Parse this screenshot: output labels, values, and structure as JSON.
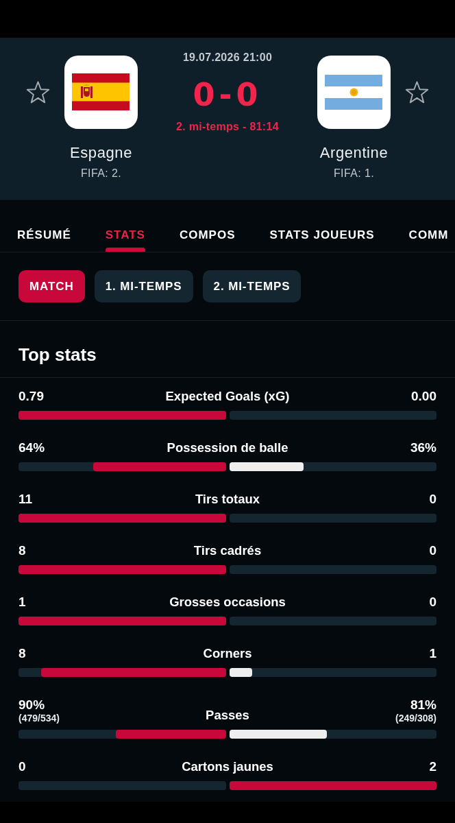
{
  "match": {
    "datetime": "19.07.2026 21:00",
    "score": "0-0",
    "status": "2. mi-temps - 81:14",
    "home": {
      "name": "Espagne",
      "ranking": "FIFA: 2.",
      "favorite": false
    },
    "away": {
      "name": "Argentine",
      "ranking": "FIFA: 1.",
      "favorite": false
    }
  },
  "tabs": [
    {
      "label": "RÉSUMÉ",
      "selected": false
    },
    {
      "label": "STATS",
      "selected": true
    },
    {
      "label": "COMPOS",
      "selected": false
    },
    {
      "label": "STATS JOUEURS",
      "selected": false
    },
    {
      "label": "COMM",
      "selected": false
    }
  ],
  "periods": [
    {
      "label": "MATCH",
      "selected": true
    },
    {
      "label": "1. MI-TEMPS",
      "selected": false
    },
    {
      "label": "2. MI-TEMPS",
      "selected": false
    }
  ],
  "section_title": "Top stats",
  "stats": [
    {
      "label": "Expected Goals (xG)",
      "home": {
        "value": "0.79",
        "level": 1
      },
      "away": {
        "value": "0.00",
        "level": 0
      }
    },
    {
      "label": "Possession de balle",
      "home": {
        "value": "64%",
        "level": 0.64
      },
      "away": {
        "value": "36%",
        "level": 0.36
      }
    },
    {
      "label": "Tirs totaux",
      "home": {
        "value": "11",
        "level": 1
      },
      "away": {
        "value": "0",
        "level": 0
      }
    },
    {
      "label": "Tirs cadrés",
      "home": {
        "value": "8",
        "level": 1
      },
      "away": {
        "value": "0",
        "level": 0
      }
    },
    {
      "label": "Grosses occasions",
      "home": {
        "value": "1",
        "level": 1
      },
      "away": {
        "value": "0",
        "level": 0
      }
    },
    {
      "label": "Corners",
      "home": {
        "value": "8",
        "level": 0.89
      },
      "away": {
        "value": "1",
        "level": 0.11
      }
    },
    {
      "label": "Passes",
      "home": {
        "value": "90%",
        "detail": "(479/534)",
        "level": 0.53
      },
      "away": {
        "value": "81%",
        "detail": "(249/308)",
        "level": 0.47
      }
    },
    {
      "label": "Cartons jaunes",
      "home": {
        "value": "0",
        "level": 0
      },
      "away": {
        "value": "2",
        "level": 1
      }
    }
  ]
}
